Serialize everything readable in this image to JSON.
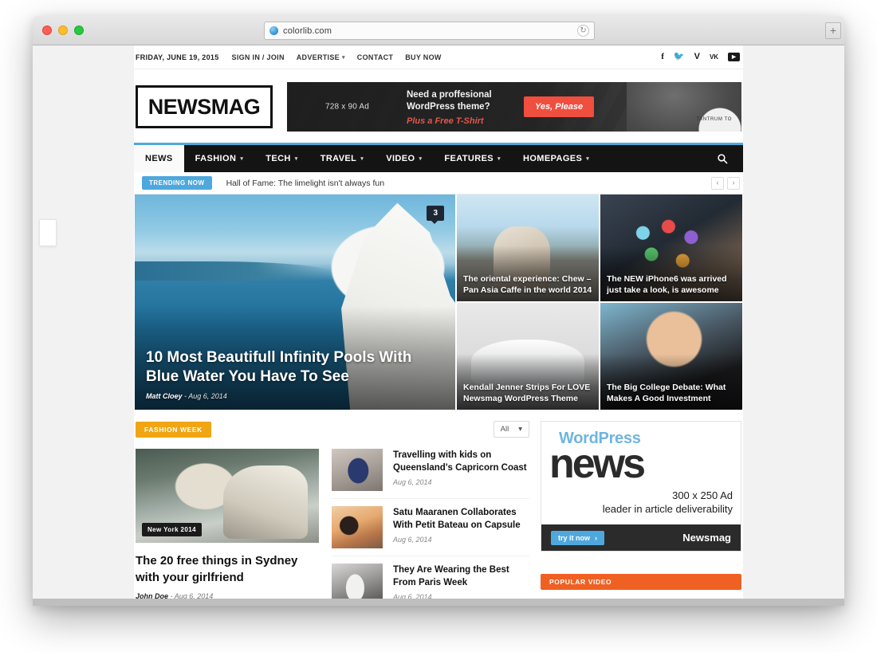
{
  "browser": {
    "url": "colorlib.com",
    "reload_icon": "reload-icon",
    "newtab_label": "+",
    "traffic_lights": [
      "close",
      "minimize",
      "maximize"
    ]
  },
  "topbar": {
    "date": "FRIDAY, JUNE 19, 2015",
    "links": [
      {
        "label": "SIGN IN / JOIN",
        "has_caret": false
      },
      {
        "label": "ADVERTISE",
        "has_caret": true
      },
      {
        "label": "CONTACT",
        "has_caret": false
      },
      {
        "label": "BUY NOW",
        "has_caret": false
      }
    ],
    "social": [
      {
        "name": "facebook-icon",
        "glyph": "f"
      },
      {
        "name": "twitter-icon",
        "glyph": "🐦"
      },
      {
        "name": "vimeo-icon",
        "glyph": "V"
      },
      {
        "name": "vk-icon",
        "glyph": "vk"
      },
      {
        "name": "youtube-icon",
        "glyph": "▶"
      }
    ]
  },
  "header": {
    "logo": "NEWSMAG",
    "ad": {
      "size_label": "728 x 90 Ad",
      "line1": "Need a proffesional",
      "line2": "WordPress theme?",
      "line3": "Plus a Free T-Shirt",
      "cta": "Yes, Please",
      "shirt_text": "TANTRUM TO"
    }
  },
  "nav": {
    "items": [
      {
        "label": "NEWS",
        "has_caret": false,
        "active": true
      },
      {
        "label": "FASHION",
        "has_caret": true,
        "active": false
      },
      {
        "label": "TECH",
        "has_caret": true,
        "active": false
      },
      {
        "label": "TRAVEL",
        "has_caret": true,
        "active": false
      },
      {
        "label": "VIDEO",
        "has_caret": true,
        "active": false
      },
      {
        "label": "FEATURES",
        "has_caret": true,
        "active": false
      },
      {
        "label": "HOMEPAGES",
        "has_caret": true,
        "active": false
      }
    ],
    "search_icon": "search-icon",
    "accent_color": "#4fa8dd"
  },
  "trending": {
    "badge": "TRENDING NOW",
    "headline": "Hall of Fame: The limelight isn't always fun",
    "prev": "‹",
    "next": "›"
  },
  "hero": {
    "main": {
      "title": "10 Most Beautifull Infinity Pools With Blue Water You Have To See",
      "author": "Matt Cloey",
      "separator": "-",
      "date": "Aug 6, 2014",
      "comment_count": "3"
    },
    "tiles": [
      {
        "title": "The oriental experience: Chew – Pan Asia Caffe in the world 2014",
        "photo": "ph-beach"
      },
      {
        "title": "The NEW iPhone6 was arrived just take a look, is awesome",
        "photo": "ph-phone"
      },
      {
        "title": "Kendall Jenner Strips For LOVE Newsmag WordPress Theme",
        "photo": "ph-car"
      },
      {
        "title": "The Big College Debate: What Makes A Good Investment",
        "photo": "ph-woman"
      }
    ]
  },
  "fashion_week": {
    "badge": "FASHION WEEK",
    "badge_color": "#f0a513",
    "filter_value": "All",
    "filter_caret": "▾",
    "feature": {
      "image_tag": "New York 2014",
      "title": "The 20 free things in Sydney with your girlfriend",
      "author": "John Doe",
      "separator": "-",
      "date": "Aug 6, 2014",
      "arrow": "›"
    },
    "list": [
      {
        "title": "Travelling with kids on Queensland's Capricorn Coast",
        "date": "Aug 6, 2014",
        "thumb": "th-shoe"
      },
      {
        "title": "Satu Maaranen Collaborates With Petit Bateau on Capsule",
        "date": "Aug 6, 2014",
        "thumb": "th-guitar"
      },
      {
        "title": "They Are Wearing the Best From Paris Week",
        "date": "Aug 6, 2014",
        "thumb": "th-street"
      }
    ]
  },
  "sidebar": {
    "ad": {
      "brand_top": "WordPress",
      "brand_big": "news",
      "line1": "300 x 250 Ad",
      "line2": "leader in article deliverability",
      "cta": "try it now",
      "cta_arrow": "›",
      "brand_right": "Newsmag"
    },
    "popular_video": {
      "badge": "POPULAR VIDEO",
      "badge_color": "#ef6023"
    }
  }
}
